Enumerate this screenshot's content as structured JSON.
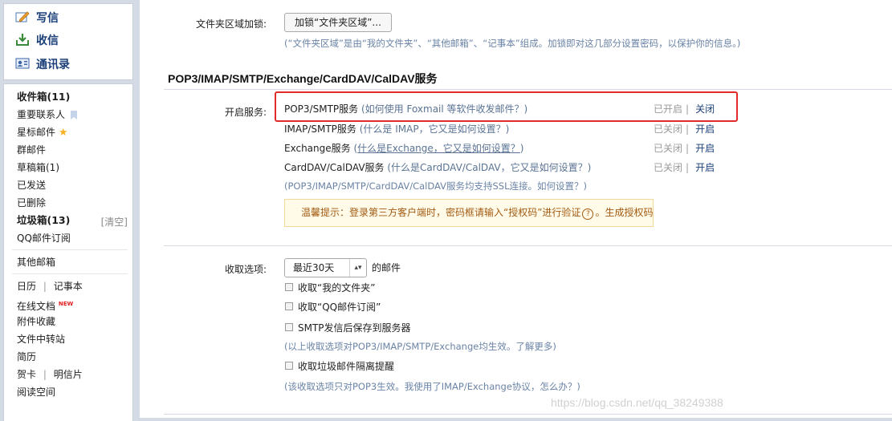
{
  "sidebar": {
    "write_label": "写信",
    "inbox_label": "收信",
    "contacts_label": "通讯录",
    "folders": {
      "inbox": "收件箱(11)",
      "important_contacts": "重要联系人",
      "starred": "星标邮件",
      "group_mail": "群邮件",
      "drafts": "草稿箱(1)",
      "sent": "已发送",
      "deleted": "已删除",
      "spam": "垃圾箱(13)",
      "spam_clear": "[清空]",
      "qq_subscription": "QQ邮件订阅",
      "other_mailboxes": "其他邮箱",
      "calendar": "日历",
      "notes": "记事本",
      "online_docs": "在线文档",
      "new_badge": "NEW",
      "attachments": "附件收藏",
      "file_transfer": "文件中转站",
      "resume": "简历",
      "greeting_card": "贺卡",
      "postcard": "明信片",
      "reading_space": "阅读空间",
      "divider": "|"
    }
  },
  "folder_lock": {
    "label": "文件夹区域加锁:",
    "button": "加锁“文件夹区域”...",
    "note": "(“文件夹区域”是由“我的文件夹”、“其他邮箱”、“记事本”组成。加锁即对这几部分设置密码，以保护你的信息。)"
  },
  "services": {
    "title": "POP3/IMAP/SMTP/Exchange/CardDAV/CalDAV服务",
    "label": "开启服务:",
    "items": [
      {
        "name": "POP3/SMTP服务",
        "help": "(如何使用 Foxmail 等软件收发邮件？)",
        "status": "已开启",
        "action": "关闭"
      },
      {
        "name": "IMAP/SMTP服务",
        "help": "(什么是 IMAP，它又是如何设置？)",
        "status": "已关闭",
        "action": "开启"
      },
      {
        "name": "Exchange服务",
        "help_pre": "(",
        "help_link": "什么是Exchange，它又是如何设置？",
        "help_post": ")",
        "status": "已关闭",
        "action": "开启"
      },
      {
        "name": "CardDAV/CalDAV服务",
        "help": "(什么是CardDAV/CalDAV，它又是如何设置？)",
        "status": "已关闭",
        "action": "开启"
      }
    ],
    "separator": "|",
    "ssl_note": "(POP3/IMAP/SMTP/CardDAV/CalDAV服务均支持SSL连接。如何设置？)",
    "tip_prefix": "温馨提示：登录第三方客户端时，密码框请输入“授权码”进行验证",
    "tip_q": "?",
    "tip_suffix": "。生成授权码"
  },
  "receive": {
    "label": "收取选项:",
    "select_value": "最近30天",
    "select_arrow": "▴▾",
    "select_suffix": "的邮件",
    "options": [
      {
        "label": "收取“我的文件夹”"
      },
      {
        "label": "收取“QQ邮件订阅”"
      },
      {
        "label": "SMTP发信后保存到服务器"
      }
    ],
    "note1": "(以上收取选项对POP3/IMAP/SMTP/Exchange均生效。了解更多)",
    "spam_option": "收取垃圾邮件隔离提醒",
    "note2": "(该收取选项只对POP3生效。我使用了IMAP/Exchange协议，怎么办？)"
  },
  "watermark": "https://blog.csdn.net/qq_38249388"
}
